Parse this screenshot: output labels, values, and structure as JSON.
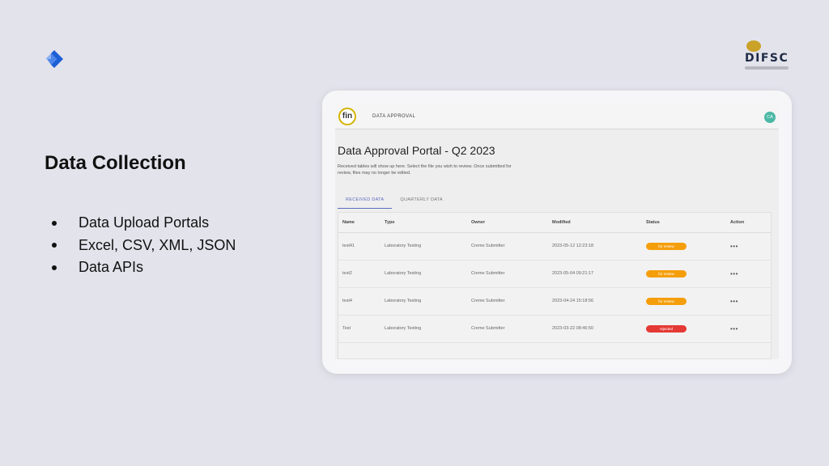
{
  "slide": {
    "title": "Data Collection",
    "bullets": [
      "Data Upload Portals",
      "Excel, CSV, XML, JSON",
      "Data APIs"
    ],
    "brand_logo_icon": "diamond-arrow-logo-icon",
    "partner_logo_text": "DIFSC",
    "colors": {
      "brand_blue": "#1e5fd6",
      "partner_gold": "#c9a227",
      "background": "#e3e3ec"
    }
  },
  "app": {
    "logo_text": "fin",
    "nav_label": "DATA APPROVAL",
    "user_initials": "CA",
    "page_title": "Data Approval Portal - Q2 2023",
    "page_description": "Received tables will show up here. Select the file you wish to review. Once submitted for review, files may no longer be edited.",
    "tabs": [
      {
        "label": "RECEIVED DATA",
        "active": true
      },
      {
        "label": "QUARTERLY DATA",
        "active": false
      }
    ],
    "table": {
      "headers": [
        "Name",
        "Type",
        "Owner",
        "Modified",
        "Status",
        "Action"
      ],
      "rows": [
        {
          "name": "test41",
          "type": "Laboratory Testing",
          "owner": "Creme Submitter",
          "modified": "2023-05-12 12:23:18",
          "status": "for review",
          "status_color": "#f59e0b",
          "action": "•••"
        },
        {
          "name": "test2",
          "type": "Laboratory Testing",
          "owner": "Creme Submitter",
          "modified": "2023-05-04 09:21:17",
          "status": "for review",
          "status_color": "#f59e0b",
          "action": "•••"
        },
        {
          "name": "test4",
          "type": "Laboratory Testing",
          "owner": "Creme Submitter",
          "modified": "2023-04-24 15:18:56",
          "status": "for review",
          "status_color": "#f59e0b",
          "action": "•••"
        },
        {
          "name": "Test",
          "type": "Laboratory Testing",
          "owner": "Creme Submitter",
          "modified": "2023-03-22 08:46:50",
          "status": "rejected",
          "status_color": "#e53935",
          "action": "•••"
        }
      ]
    }
  }
}
